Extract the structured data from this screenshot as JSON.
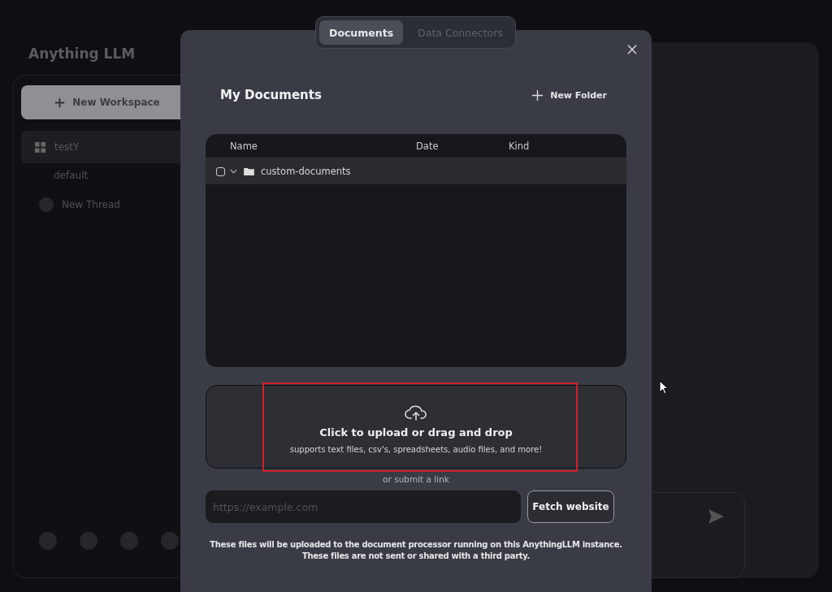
{
  "app": {
    "logo": "Anything LLM",
    "new_workspace": "New Workspace",
    "workspaces": [
      {
        "name": "testY",
        "selected": true,
        "threads": [
          {
            "name": "default"
          }
        ]
      }
    ],
    "new_thread": "New Thread"
  },
  "modal": {
    "tabs": [
      {
        "label": "Documents",
        "selected": true
      },
      {
        "label": "Data Connectors",
        "selected": false
      }
    ],
    "title": "My Documents",
    "new_folder": "New Folder",
    "table": {
      "columns": [
        "Name",
        "Date",
        "Kind"
      ],
      "rows": [
        {
          "name": "custom-documents",
          "checked": false,
          "expanded": true
        }
      ]
    },
    "upload": {
      "title": "Click to upload or drag and drop",
      "subtitle": "supports text files, csv's, spreadsheets, audio files, and more!"
    },
    "link_hint": "or submit a link",
    "url_field": {
      "placeholder": "https://example.com"
    },
    "fetch_button": "Fetch website",
    "footer": [
      "These files will be uploaded to the document processor running on this AnythingLLM instance.",
      "These files are not sent or shared with a third party."
    ]
  }
}
